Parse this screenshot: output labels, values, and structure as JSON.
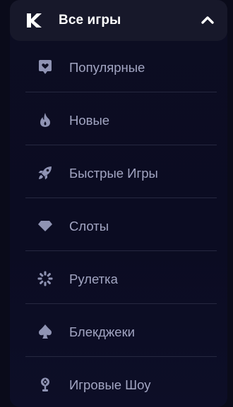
{
  "header": {
    "title": "Все игры",
    "logo_icon": "k-logo-icon",
    "toggle_icon": "chevron-up-icon"
  },
  "menu": {
    "items": [
      {
        "label": "Популярные",
        "icon": "heart-badge-icon"
      },
      {
        "label": "Новые",
        "icon": "flame-icon"
      },
      {
        "label": "Быстрые Игры",
        "icon": "rocket-icon"
      },
      {
        "label": "Слоты",
        "icon": "diamond-icon"
      },
      {
        "label": "Рулетка",
        "icon": "roulette-wheel-icon"
      },
      {
        "label": "Блекджеки",
        "icon": "spade-icon"
      },
      {
        "label": "Игровые Шоу",
        "icon": "microphone-icon"
      }
    ]
  },
  "colors": {
    "background": "#0a0b1a",
    "panel": "#0c0d22",
    "header": "#17182a",
    "text_primary": "#ffffff",
    "text_secondary": "#a2a5c2",
    "icon": "#8f93b3",
    "divider": "#262840"
  }
}
